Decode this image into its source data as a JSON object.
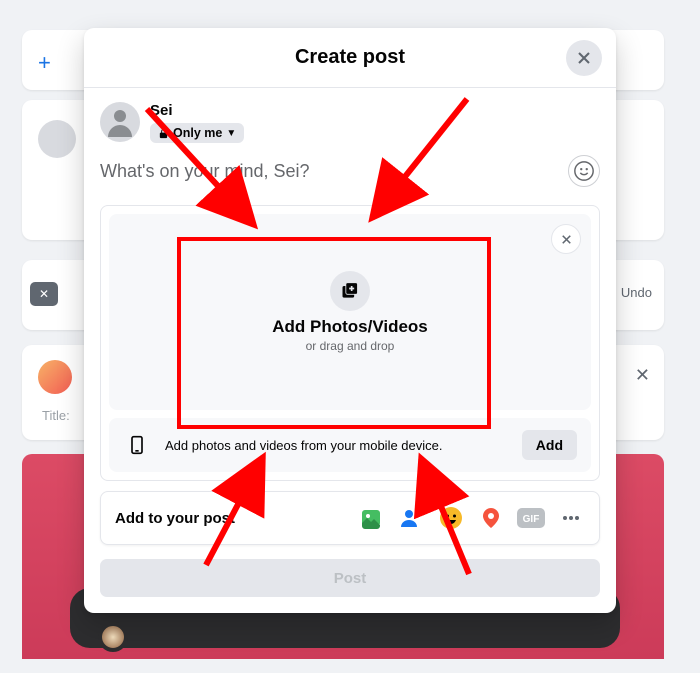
{
  "modal": {
    "title": "Create post",
    "user_name": "Sei",
    "privacy_label": "Only me",
    "composer_placeholder": "What's on your mind, Sei?",
    "upload": {
      "label": "Add Photos/Videos",
      "sublabel": "or drag and drop"
    },
    "mobile": {
      "text": "Add photos and videos from your mobile device.",
      "button": "Add"
    },
    "addons_label": "Add to your post",
    "post_button": "Post"
  },
  "background": {
    "title_placeholder": "Title:",
    "undo_label": "Undo"
  },
  "annotation": {
    "highlight_color": "#ff0000"
  }
}
